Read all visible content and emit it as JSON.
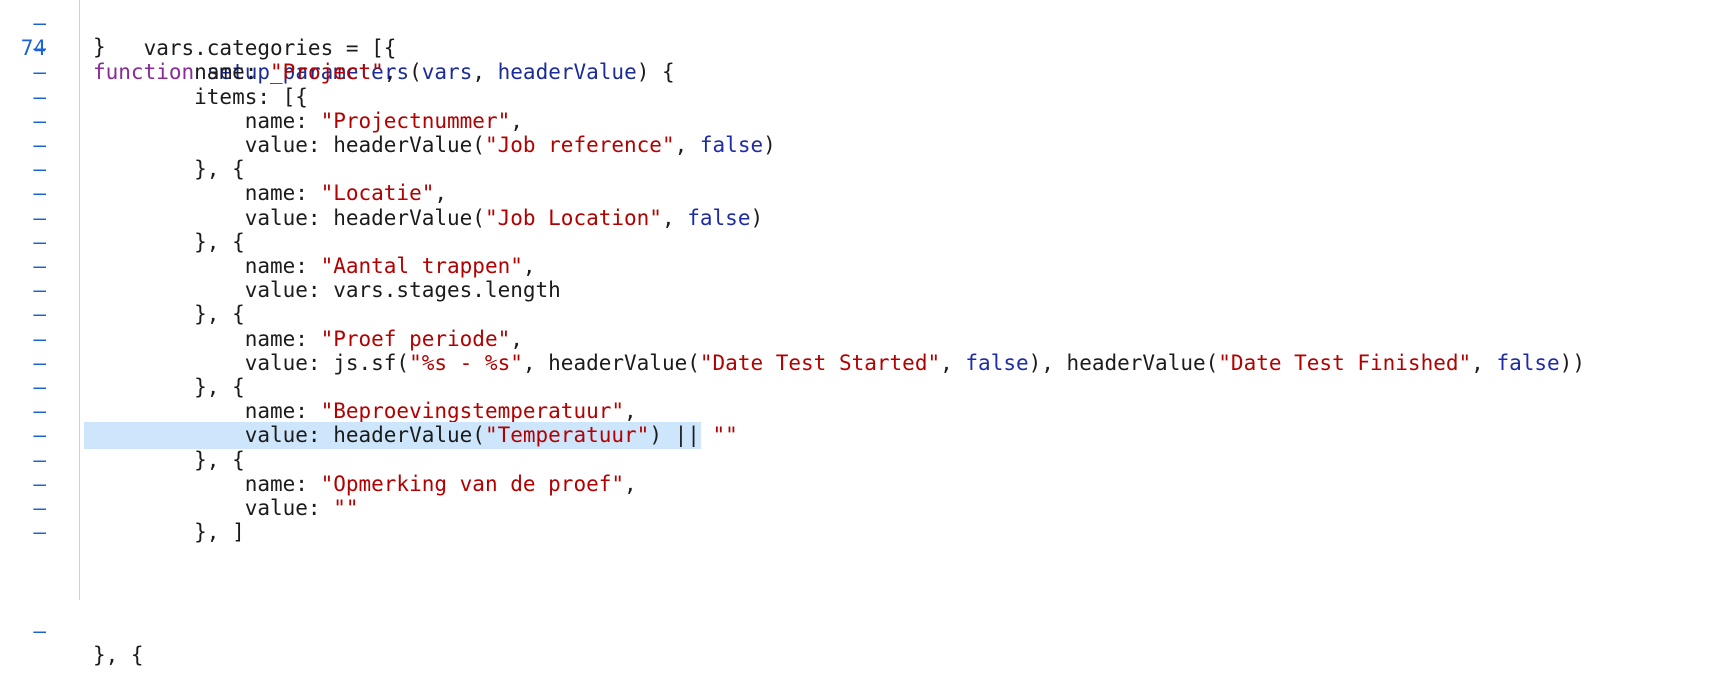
{
  "editor": {
    "current_line_number": "74",
    "collapsed_marker": "–",
    "top_partial": "}",
    "bottom_partial": "}, {",
    "lines": [
      {
        "kw": "function",
        "fn": "setup_parameters",
        "p": "(",
        "a1": "vars",
        ", ": ", ",
        "a2": "headerValue",
        "tail": ") {"
      },
      {
        "t": "    vars.categories = [{"
      },
      {
        "pre": "        name: ",
        "s": "\"Project\"",
        "post": ","
      },
      {
        "t": "        items: [{"
      },
      {
        "pre": "            name: ",
        "s": "\"Projectnummer\"",
        "post": ","
      },
      {
        "pre": "            value: headerValue(",
        "s": "\"Job reference\"",
        "mid": ", ",
        "b": "false",
        "post": ")"
      },
      {
        "t": "        }, {"
      },
      {
        "pre": "            name: ",
        "s": "\"Locatie\"",
        "post": ","
      },
      {
        "pre": "            value: headerValue(",
        "s": "\"Job Location\"",
        "mid": ", ",
        "b": "false",
        "post": ")"
      },
      {
        "t": "        }, {"
      },
      {
        "pre": "            name: ",
        "s": "\"Aantal trappen\"",
        "post": ","
      },
      {
        "t": "            value: vars.stages.length"
      },
      {
        "t": "        }, {"
      },
      {
        "pre": "            name: ",
        "s": "\"Proef periode\"",
        "post": ","
      },
      {
        "pre": "            value: js.sf(",
        "s": "\"%s - %s\"",
        "mid": ", headerValue(",
        "s2": "\"Date Test Started\"",
        "mid2": ", ",
        "b": "false",
        "mid3": "), headerValue(",
        "s3": "\"Date Test Finished\"",
        "mid4": ", ",
        "b2": "false",
        "post": "))"
      },
      {
        "t": "        }, {"
      },
      {
        "pre": "            name: ",
        "s": "\"Beproevingstemperatuur\"",
        "post": ","
      },
      {
        "pre": "            value: headerValue(",
        "s": "\"Temperatuur\"",
        "mid": ") || ",
        "s2": "\"\"",
        "highlight": true
      },
      {
        "t": "        }, {"
      },
      {
        "pre": "            name: ",
        "s": "\"Opmerking van de proef\"",
        "post": ","
      },
      {
        "pre": "            value: ",
        "s": "\"\""
      },
      {
        "t": "        }, ]"
      }
    ]
  }
}
